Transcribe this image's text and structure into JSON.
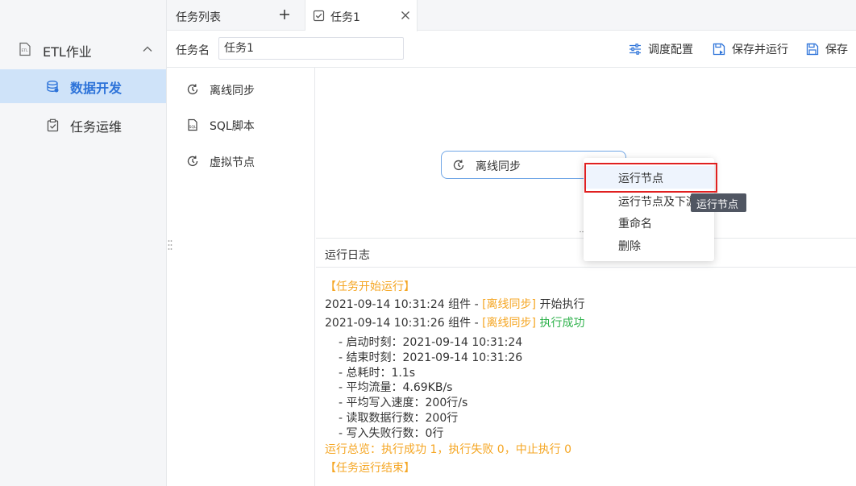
{
  "sidebar": {
    "group": {
      "label": "ETL作业",
      "icon": "etl-file-icon"
    },
    "items": [
      {
        "label": "数据开发",
        "icon": "database-icon",
        "active": true
      },
      {
        "label": "任务运维",
        "icon": "clipboard-check-icon",
        "active": false
      }
    ]
  },
  "tabs": {
    "list_label": "任务列表",
    "add_icon": "plus-icon",
    "active_label": "任务1",
    "active_icon": "task-check-icon",
    "close_icon": "close-icon"
  },
  "toolbar": {
    "task_name_label": "任务名",
    "task_name_value": "任务1",
    "schedule_label": "调度配置",
    "save_run_label": "保存并运行",
    "save_label": "保存"
  },
  "components": [
    {
      "label": "离线同步",
      "icon": "sync-clock-icon"
    },
    {
      "label": "SQL脚本",
      "icon": "sql-script-icon"
    },
    {
      "label": "虚拟节点",
      "icon": "sync-clock-icon"
    }
  ],
  "canvas": {
    "node_label": "离线同步"
  },
  "context_menu": {
    "items": [
      "运行节点",
      "运行节点及下游",
      "重命名",
      "删除"
    ]
  },
  "tooltip": "运行节点",
  "log": {
    "title": "运行日志",
    "start": "【任务开始运行】",
    "line1": {
      "time": "2021-09-14 10:31:24 组件 - ",
      "tag": "[离线同步]",
      "msg": " 开始执行"
    },
    "line2": {
      "time": "2021-09-14 10:31:26 组件 - ",
      "tag": "[离线同步]",
      "msg": " 执行成功"
    },
    "details": [
      "- 启动时刻：2021-09-14 10:31:24",
      "- 结束时刻：2021-09-14 10:31:26",
      "- 总耗时：1.1s",
      "- 平均流量：4.69KB/s",
      "- 平均写入速度：200行/s",
      "- 读取数据行数：200行",
      "- 写入失败行数：0行"
    ],
    "summary": "运行总览：执行成功 1，执行失败 0，中止执行 0",
    "end": "【任务运行结束】"
  },
  "colors": {
    "accent": "#2d73d9",
    "warning": "#f5a623",
    "success": "#2fb24c",
    "highlight_box": "#e02020"
  }
}
